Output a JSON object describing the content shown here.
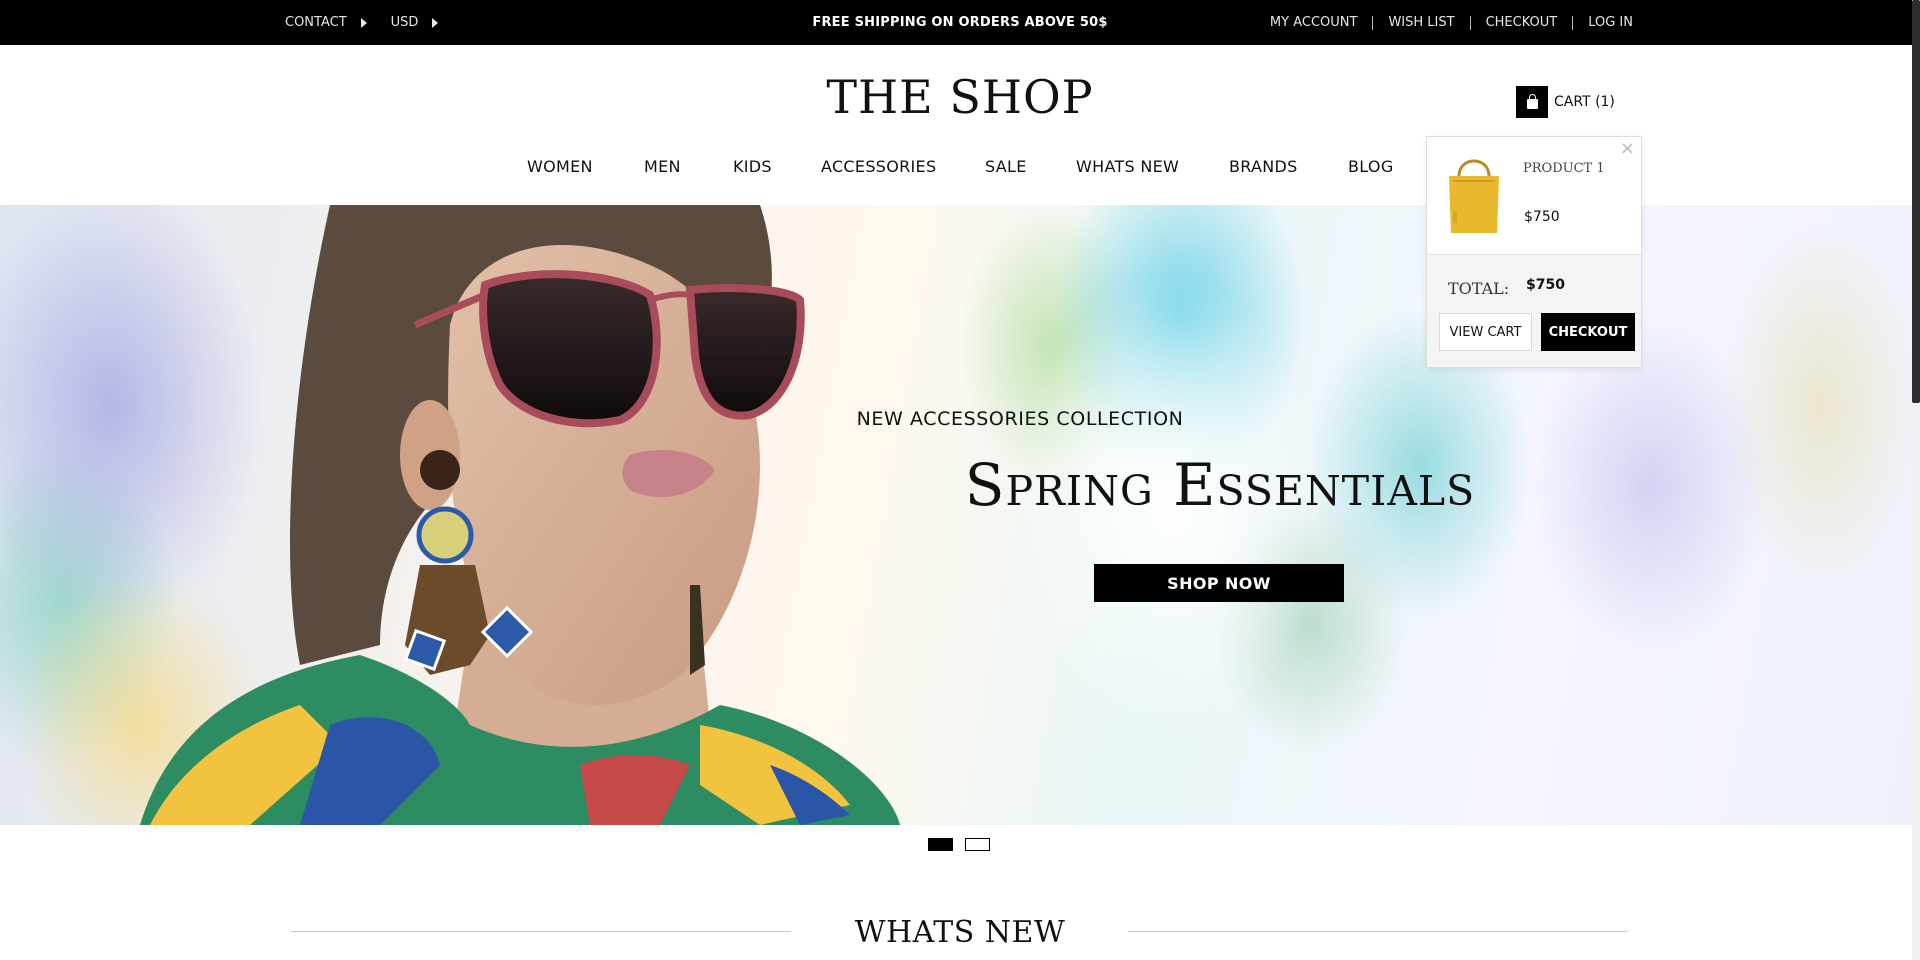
{
  "topbar": {
    "contact_label": "CONTACT",
    "currency_label": "USD",
    "promo": "FREE SHIPPING ON ORDERS ABOVE 50$",
    "links": [
      "MY ACCOUNT",
      "WISH LIST",
      "CHECKOUT",
      "LOG IN"
    ]
  },
  "header": {
    "logo": "THE SHOP",
    "cart_label": "CART (1)"
  },
  "nav": {
    "items": [
      "WOMEN",
      "MEN",
      "KIDS",
      "ACCESSORIES",
      "SALE",
      "WHATS NEW",
      "BRANDS",
      "BLOG"
    ]
  },
  "hero": {
    "subtitle": "NEW ACCESSORIES COLLECTION",
    "title": "Spring Essentials",
    "button_label": "SHOP NOW"
  },
  "cart_dropdown": {
    "close_glyph": "×",
    "product_name": "PRODUCT 1",
    "product_price": "$750",
    "total_label": "TOTAL:",
    "total_value": "$750",
    "view_cart_label": "VIEW CART",
    "checkout_label": "CHECKOUT"
  },
  "slider": {
    "slide_count": 2,
    "active_index": 0
  },
  "section": {
    "title": "WHATS NEW"
  }
}
